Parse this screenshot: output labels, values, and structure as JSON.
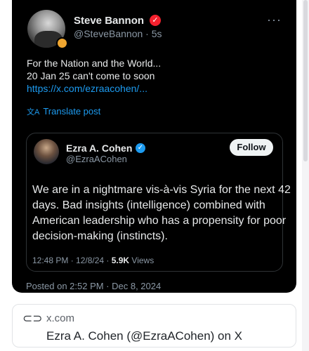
{
  "post": {
    "author": {
      "name": "Steve Bannon",
      "handle": "@SteveBannon · 5s",
      "verified_badge": "✓"
    },
    "more_glyph": "···",
    "text_lines": [
      "For the Nation and the World...",
      "20 Jan 25 can't come to soon"
    ],
    "link": "https://x.com/ezraacohen/...",
    "translate_label": "Translate post",
    "translate_icon_glyph": "文A",
    "quoted": {
      "author": {
        "name": "Ezra A. Cohen",
        "handle": "@EzraACohen",
        "verified_badge": "✓"
      },
      "follow_label": "Follow",
      "text_lines": [
        "We are in a nightmare vis-à-vis Syria for the next 42",
        "days. Bad insights (intelligence) combined with",
        "American leadership who has a propensity for poor",
        "decision-making (instincts)."
      ],
      "meta_time": "12:48 PM · 12/8/24 · ",
      "meta_views_count": "5.9K",
      "meta_views_label": " Views"
    },
    "posted_on": "Posted on 2:52 PM · Dec 8, 2024"
  },
  "link_preview": {
    "domain": "x.com",
    "title": "Ezra A. Cohen (@EzraACohen) on X",
    "icon": "link-icon",
    "icon_glyph": "⊂⊃"
  },
  "colors": {
    "card_bg": "#000000",
    "text_primary": "#e7e9ea",
    "text_secondary": "#8b98a5",
    "link": "#1d9bf0",
    "verified_red": "#f4212e",
    "verified_blue": "#1d9bf0"
  }
}
